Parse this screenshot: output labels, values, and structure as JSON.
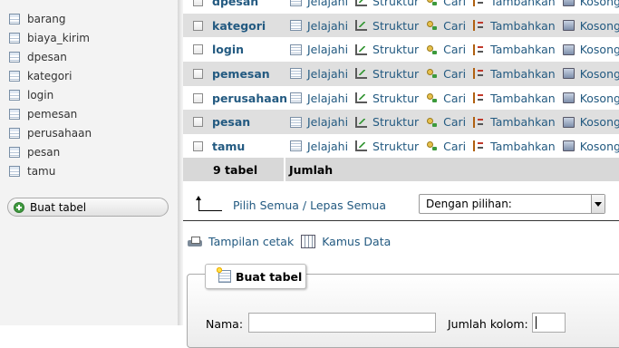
{
  "sidebar": {
    "tables": [
      "barang",
      "biaya_kirim",
      "dpesan",
      "kategori",
      "login",
      "pemesan",
      "perusahaan",
      "pesan",
      "tamu"
    ],
    "create_table_label": "Buat tabel"
  },
  "table_list": {
    "rows": [
      {
        "name": "dpesan"
      },
      {
        "name": "kategori"
      },
      {
        "name": "login"
      },
      {
        "name": "pemesan"
      },
      {
        "name": "perusahaan"
      },
      {
        "name": "pesan"
      },
      {
        "name": "tamu"
      }
    ],
    "actions": {
      "browse": "Jelajahi",
      "structure": "Struktur",
      "search": "Cari",
      "insert": "Tambahkan",
      "empty": "Kosongkan"
    },
    "footer_count": "9 tabel",
    "footer_sum": "Jumlah"
  },
  "select_bar": {
    "check_all_label": "Pilih Semua / Lepas Semua",
    "with_selected_value": "Dengan pilihan:"
  },
  "links": {
    "print_view": "Tampilan cetak",
    "data_dictionary": "Kamus Data"
  },
  "create_form": {
    "legend": "Buat tabel",
    "name_label": "Nama:",
    "name_value": "",
    "columns_label": "Jumlah kolom:",
    "columns_value": ""
  }
}
